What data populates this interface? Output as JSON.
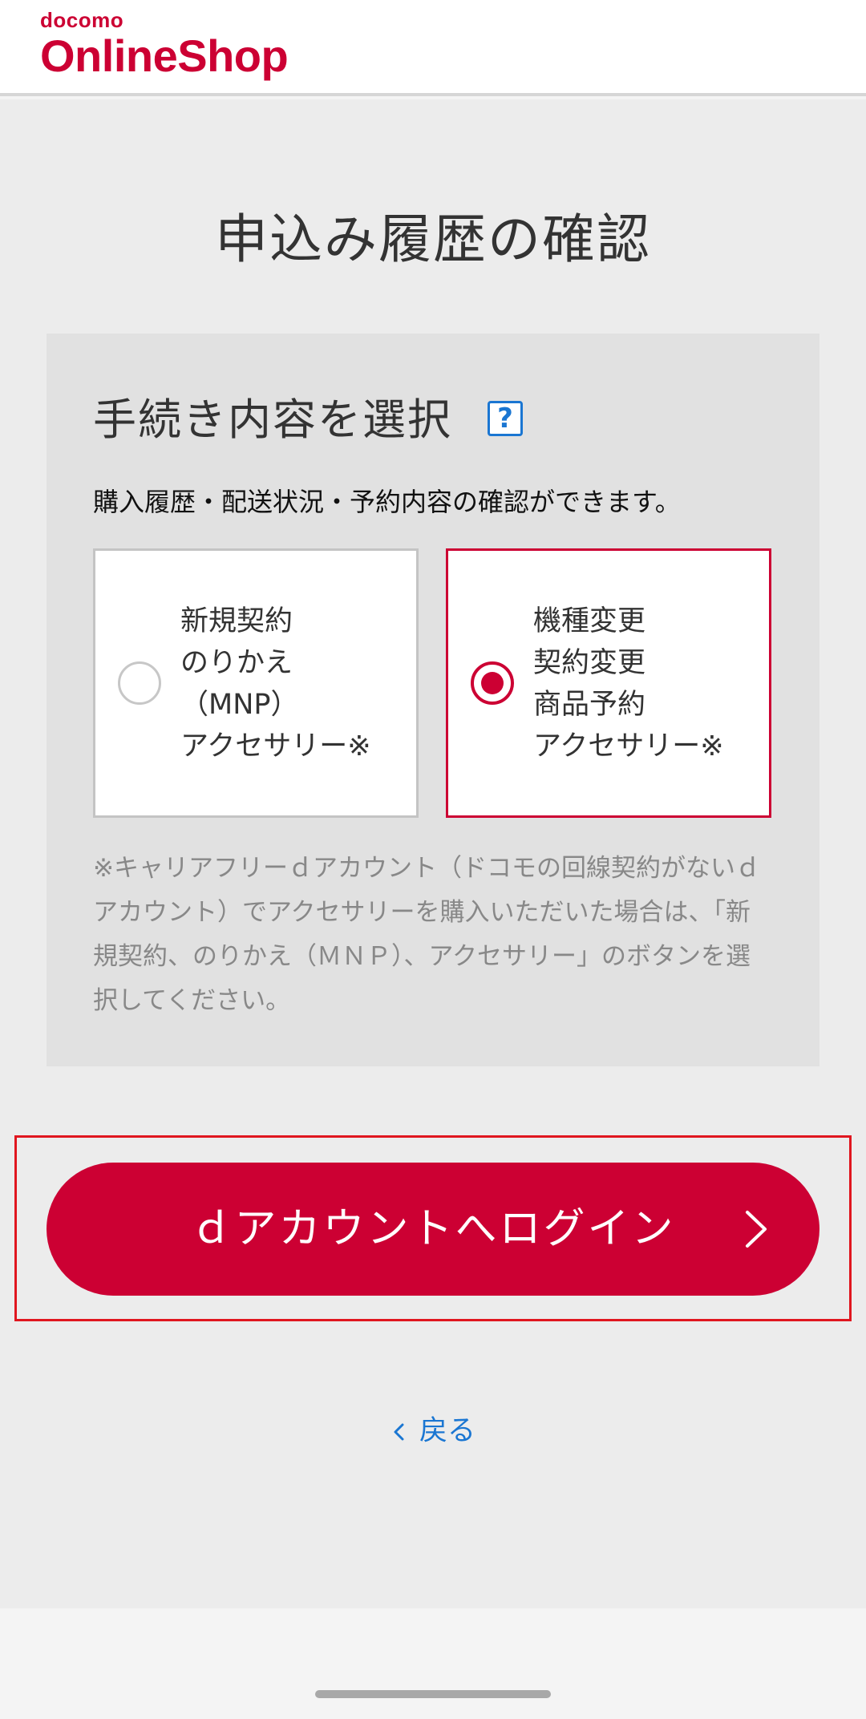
{
  "header": {
    "logo_small": "docomo",
    "logo_main": "OnlineShop",
    "brand_color": "#cc0033"
  },
  "page": {
    "title": "申込み履歴の確認"
  },
  "selection": {
    "heading": "手続き内容を選択",
    "help_icon": "question-mark-icon",
    "help_label": "?",
    "description": "購入履歴・配送状況・予約内容の確認ができます。",
    "options": [
      {
        "lines": [
          "新規契約",
          "のりかえ",
          "（MNP）",
          "アクセサリー※"
        ],
        "selected": false
      },
      {
        "lines": [
          "機種変更",
          "契約変更",
          "商品予約",
          "アクセサリー※"
        ],
        "selected": true
      }
    ],
    "note": "※キャリアフリーｄアカウント（ドコモの回線契約がないｄアカウント）でアクセサリーを購入いただいた場合は、「新規契約、のりかえ（ＭＮＰ）、アクセサリー」のボタンを選択してください。"
  },
  "login_button": {
    "label": "ｄアカウントへログイン",
    "icon": "chevron-right-icon",
    "color": "#cc0033"
  },
  "back_link": {
    "label": "戻る",
    "icon": "chevron-left-icon",
    "color": "#1a76d2"
  }
}
